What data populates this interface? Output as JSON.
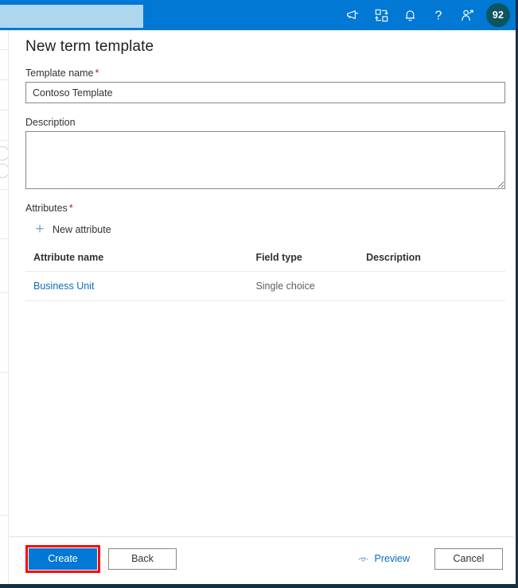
{
  "topbar": {
    "background_color": "#0078D4",
    "search": {
      "value": "",
      "placeholder": ""
    },
    "icons": [
      {
        "name": "megaphone-icon",
        "label": "Announcements"
      },
      {
        "name": "sync-transfer-icon",
        "label": "Data map"
      },
      {
        "name": "bell-icon",
        "label": "Notifications"
      },
      {
        "name": "question-mark-icon",
        "label": "Help"
      },
      {
        "name": "person-settings-icon",
        "label": "Account settings"
      }
    ],
    "avatar": {
      "text": "92",
      "color": "#0C5460"
    }
  },
  "page": {
    "title": "New term template"
  },
  "form": {
    "template_name": {
      "label": "Template name",
      "required_marker": "*",
      "value": "Contoso Template",
      "placeholder": ""
    },
    "description": {
      "label": "Description",
      "value": "",
      "placeholder": ""
    },
    "attributes": {
      "label": "Attributes",
      "required_marker": "*",
      "new_attribute_label": "New attribute",
      "plus_icon": "+",
      "columns": [
        "Attribute name",
        "Field type",
        "Description"
      ],
      "rows": [
        {
          "attribute_name": "Business Unit",
          "field_type": "Single choice",
          "description": ""
        }
      ]
    }
  },
  "footer": {
    "create_label": "Create",
    "back_label": "Back",
    "preview_label": "Preview",
    "cancel_label": "Cancel",
    "highlight_color": "#FF0000",
    "primary_color": "#0078D4"
  }
}
